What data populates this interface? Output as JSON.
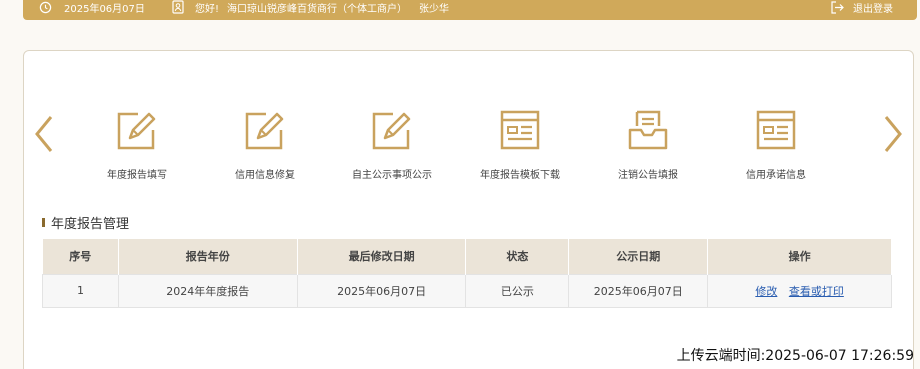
{
  "header": {
    "date": "2025年06月07日",
    "greeting": "您好!",
    "company": "海口琼山锐彦峰百货商行（个体工商户）",
    "user": "张少华",
    "logout_label": "退出登录"
  },
  "quick_links": [
    {
      "label": "年度报告填写",
      "icon": "edit-icon"
    },
    {
      "label": "信用信息修复",
      "icon": "edit-icon"
    },
    {
      "label": "自主公示事项公示",
      "icon": "edit-icon"
    },
    {
      "label": "年度报告模板下载",
      "icon": "template-icon"
    },
    {
      "label": "注销公告填报",
      "icon": "tray-icon"
    },
    {
      "label": "信用承诺信息",
      "icon": "template-icon"
    }
  ],
  "section": {
    "title": "年度报告管理"
  },
  "table": {
    "columns": [
      "序号",
      "报告年份",
      "最后修改日期",
      "状态",
      "公示日期",
      "操作"
    ],
    "rows": [
      {
        "index": "1",
        "year": "2024年年度报告",
        "modified": "2025年06月07日",
        "status": "已公示",
        "published": "2025年06月07日",
        "actions": [
          "修改",
          "查看或打印"
        ]
      }
    ]
  },
  "upload_time": "上传云端时间:2025-06-07 17:26:59",
  "colors": {
    "accent": "#d0a95a",
    "icon": "#c9a25e",
    "link": "#2a5db0",
    "table_header": "#ebe4d8"
  }
}
